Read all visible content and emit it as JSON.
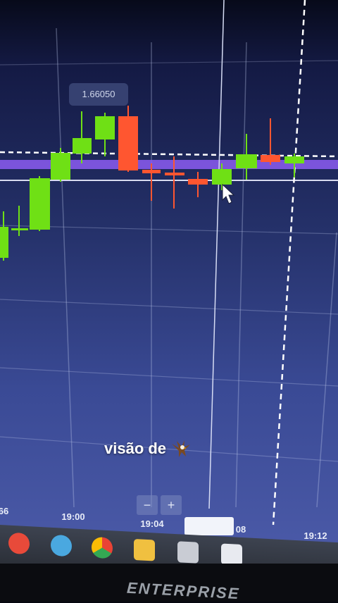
{
  "chart": {
    "price_tag": "1.66050",
    "time_labels": [
      "66",
      "19:00",
      "19:04",
      "08",
      "19:12"
    ],
    "colors": {
      "up": "#6fe015",
      "down": "#ff5630",
      "line": "#9a6bff"
    }
  },
  "chart_data": {
    "type": "candlestick",
    "title": "",
    "x_ticks": [
      "19:00",
      "19:04",
      "19:12"
    ],
    "price_label": "1.66050"
  },
  "zoom": {
    "minus_label": "−",
    "plus_label": "+"
  },
  "caption": {
    "text": "visão de",
    "icon": "eagle-icon"
  },
  "taskbar": {
    "icons": [
      "media-player-icon",
      "browser-icon",
      "chrome-icon",
      "folder-icon",
      "calculator-icon",
      "photos-icon"
    ]
  },
  "monitor": {
    "brand": "ENTERPRISE"
  }
}
